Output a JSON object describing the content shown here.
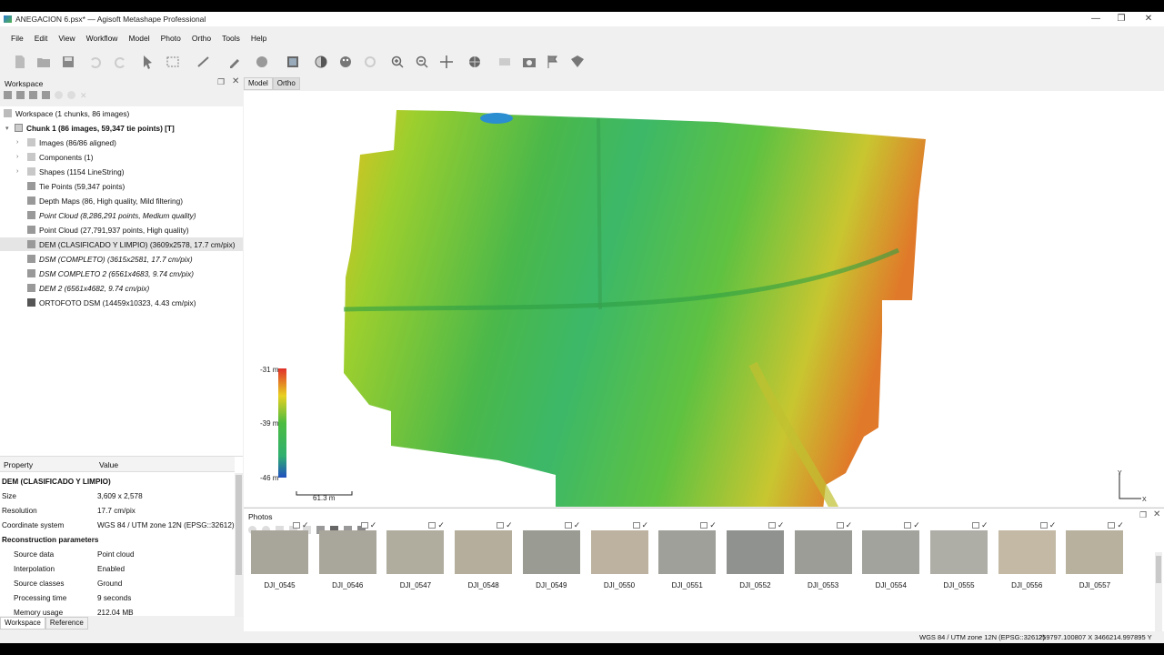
{
  "window": {
    "title": "ANEGACION 6.psx* — Agisoft Metashape Professional",
    "controls": [
      "minimize",
      "restore",
      "close"
    ]
  },
  "menu": [
    "File",
    "Edit",
    "View",
    "Workflow",
    "Model",
    "Photo",
    "Ortho",
    "Tools",
    "Help"
  ],
  "toolbar": {
    "icons": [
      "new-icon",
      "open-icon",
      "save-icon",
      "undo-icon",
      "redo-icon",
      "navigation-icon",
      "rectangle-select-icon",
      "ruler-icon",
      "draw-icon",
      "brush-icon",
      "shape-icon",
      "ortho-icon",
      "contrast-icon",
      "palette-icon",
      "refresh-icon",
      "zoom-in-icon",
      "zoom-out-icon",
      "move-icon",
      "globe-icon",
      "image-icon",
      "camera-icon",
      "flag-icon",
      "map-icon"
    ]
  },
  "workspace": {
    "title": "Workspace",
    "root": "Workspace (1 chunks, 86 images)",
    "chunk": "Chunk 1 (86 images, 59,347 tie points) [T]",
    "items": [
      {
        "label": "Images (86/86 aligned)",
        "italic": false
      },
      {
        "label": "Components (1)",
        "italic": false
      },
      {
        "label": "Shapes (1154 LineString)",
        "italic": false
      },
      {
        "label": "Tie Points (59,347 points)",
        "italic": false
      },
      {
        "label": "Depth Maps (86, High quality, Mild filtering)",
        "italic": false
      },
      {
        "label": "Point Cloud (8,286,291 points, Medium quality)",
        "italic": true
      },
      {
        "label": "Point Cloud (27,791,937 points, High quality)",
        "italic": false
      },
      {
        "label": "DEM (CLASIFICADO Y LIMPIO) (3609x2578, 17.7 cm/pix)",
        "italic": false
      },
      {
        "label": "DSM (COMPLETO) (3615x2581, 17.7 cm/pix)",
        "italic": true
      },
      {
        "label": "DSM COMPLETO 2 (6561x4683, 9.74 cm/pix)",
        "italic": true
      },
      {
        "label": "DEM 2 (6561x4682, 9.74 cm/pix)",
        "italic": true
      },
      {
        "label": "ORTOFOTO DSM (14459x10323, 4.43 cm/pix)",
        "italic": false
      }
    ]
  },
  "properties": {
    "header_property": "Property",
    "header_value": "Value",
    "title": "DEM (CLASIFICADO Y LIMPIO)",
    "rows": [
      {
        "k": "Size",
        "v": "3,609 x 2,578"
      },
      {
        "k": "Resolution",
        "v": "17.7 cm/pix"
      },
      {
        "k": "Coordinate system",
        "v": "WGS 84 / UTM zone 12N (EPSG::32612)"
      }
    ],
    "section": "Reconstruction parameters",
    "recon": [
      {
        "k": "Source data",
        "v": "Point cloud"
      },
      {
        "k": "Interpolation",
        "v": "Enabled"
      },
      {
        "k": "Source classes",
        "v": "Ground"
      },
      {
        "k": "Processing time",
        "v": "9 seconds"
      },
      {
        "k": "Memory usage",
        "v": "212.04 MB"
      }
    ]
  },
  "bottom_tabs": [
    "Workspace",
    "Reference"
  ],
  "view_tabs": [
    "Model",
    "Ortho"
  ],
  "legend": {
    "max": "-31 m",
    "mid": "-39 m",
    "min": "-46 m"
  },
  "scale_bar": "61.3 m",
  "axes": {
    "y": "Y",
    "x": "X"
  },
  "photos": {
    "title": "Photos",
    "items": [
      "DJI_0545",
      "DJI_0546",
      "DJI_0547",
      "DJI_0548",
      "DJI_0549",
      "DJI_0550",
      "DJI_0551",
      "DJI_0552",
      "DJI_0553",
      "DJI_0554",
      "DJI_0555",
      "DJI_0556",
      "DJI_0557"
    ]
  },
  "status": {
    "crs": "WGS 84 / UTM zone 12N (EPSG::32612)",
    "coords": "259797.100807 X  3466214.997895 Y"
  },
  "colors": {
    "dem_low": "#2050c0",
    "dem_mid": "#3ab54a",
    "dem_high": "#e0302a"
  }
}
